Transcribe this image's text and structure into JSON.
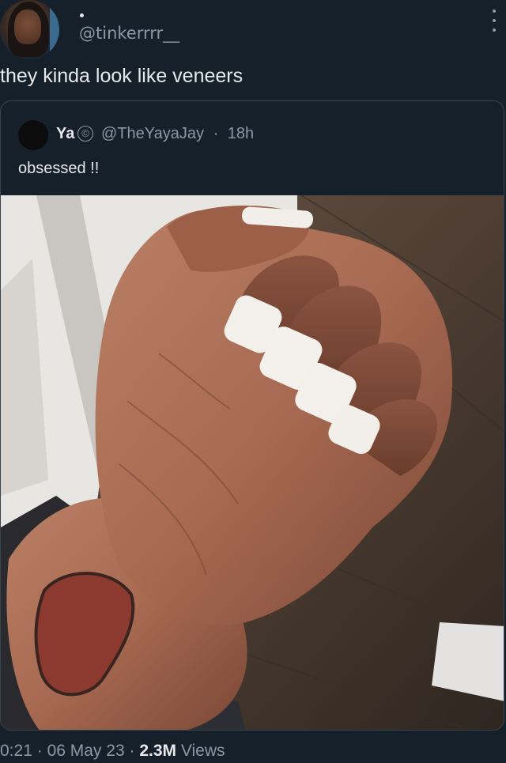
{
  "author": {
    "handle": "@tinkerrrr__"
  },
  "tweet": {
    "text": "they kinda look like veneers"
  },
  "quoted": {
    "name": "Ya",
    "handle": "@TheYayaJay",
    "separator": "·",
    "time": "18h",
    "text": "obsessed !!",
    "badge_icon": "copyright-icon",
    "image_description_icon": "photo"
  },
  "footer": {
    "time": "0:21",
    "sep1": "·",
    "date": "06 May 23",
    "sep2": "·",
    "views_count": "2.3M",
    "views_label": "Views"
  },
  "colors": {
    "background": "#15202b",
    "text_primary": "#e7e9ea",
    "text_secondary": "#8b98a5",
    "border": "#38444d"
  }
}
